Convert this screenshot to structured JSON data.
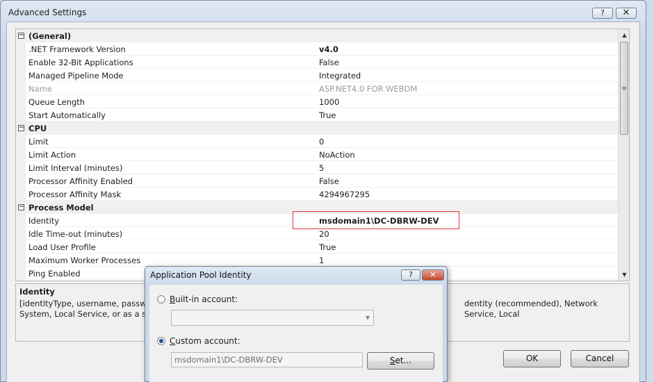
{
  "window": {
    "title": "Advanced Settings",
    "help_label": "?",
    "close_label": "✕"
  },
  "grid": {
    "rows": [
      {
        "type": "cat",
        "label": "(General)",
        "toggle": "−"
      },
      {
        "type": "item",
        "label": ".NET Framework Version",
        "value": "v4.0",
        "bold": true
      },
      {
        "type": "item",
        "label": "Enable 32-Bit Applications",
        "value": "False"
      },
      {
        "type": "item",
        "label": "Managed Pipeline Mode",
        "value": "Integrated"
      },
      {
        "type": "item",
        "label": "Name",
        "value": "ASP.NET4.0 FOR WEBDM",
        "disabled": true
      },
      {
        "type": "item",
        "label": "Queue Length",
        "value": "1000"
      },
      {
        "type": "item",
        "label": "Start Automatically",
        "value": "True"
      },
      {
        "type": "cat",
        "label": "CPU",
        "toggle": "−"
      },
      {
        "type": "item",
        "label": "Limit",
        "value": "0"
      },
      {
        "type": "item",
        "label": "Limit Action",
        "value": "NoAction"
      },
      {
        "type": "item",
        "label": "Limit Interval (minutes)",
        "value": "5"
      },
      {
        "type": "item",
        "label": "Processor Affinity Enabled",
        "value": "False"
      },
      {
        "type": "item",
        "label": "Processor Affinity Mask",
        "value": "4294967295"
      },
      {
        "type": "cat",
        "label": "Process Model",
        "toggle": "−"
      },
      {
        "type": "item",
        "label": "Identity",
        "value": "msdomain1\\DC-DBRW-DEV",
        "bold": true
      },
      {
        "type": "item",
        "label": "Idle Time-out (minutes)",
        "value": "20"
      },
      {
        "type": "item",
        "label": "Load User Profile",
        "value": "True"
      },
      {
        "type": "item",
        "label": "Maximum Worker Processes",
        "value": "1"
      },
      {
        "type": "item",
        "label": "Ping Enabled",
        "value": ""
      }
    ]
  },
  "description": {
    "title": "Identity",
    "line1_left": "[identityType, username, password",
    "line1_right": "dentity (recommended), Network Service, Local",
    "line2_left": "System, Local Service, or as a speci"
  },
  "buttons": {
    "ok": "OK",
    "cancel": "Cancel"
  },
  "dialog": {
    "title": "Application Pool Identity",
    "help_label": "?",
    "close_label": "✕",
    "builtin_label": "Built-in account:",
    "builtin_hotkey": "B",
    "builtin_rest": "uilt-in account:",
    "builtin_value": "",
    "custom_hotkey": "C",
    "custom_rest": "ustom account:",
    "custom_value": "msdomain1\\DC-DBRW-DEV",
    "set_hotkey": "S",
    "set_rest": "et...",
    "selected": "custom"
  }
}
